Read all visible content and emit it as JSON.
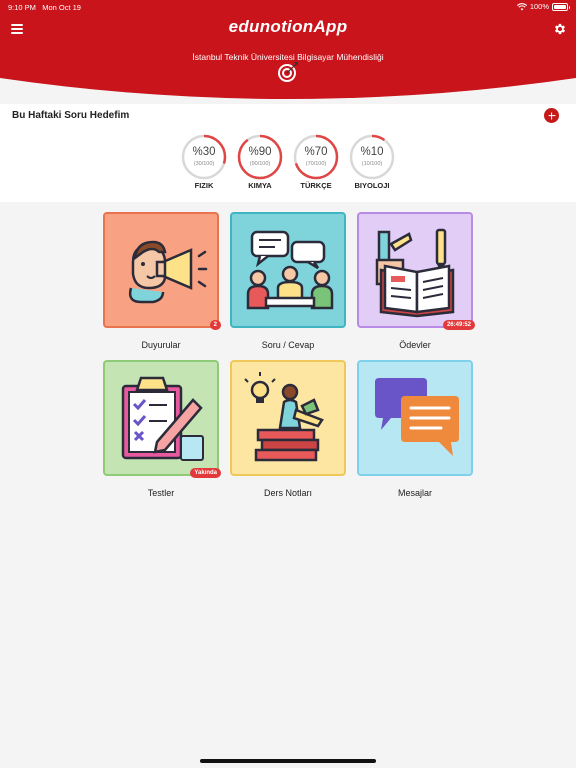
{
  "status_bar": {
    "time": "9:10 PM",
    "date": "Mon Oct 19",
    "battery": "100%"
  },
  "header": {
    "title": "edunotionApp",
    "subtitle": "İstanbul Teknik Üniversitesi Bilgisayar Mühendisliği",
    "colors": {
      "primary": "#c9141c",
      "accent": "#b01018"
    },
    "icons": {
      "menu": "hamburger-icon",
      "settings": "gear-icon",
      "target": "target-icon"
    }
  },
  "goals": {
    "title": "Bu Haftaki Soru Hedefim",
    "items": [
      {
        "percent": "%30",
        "fraction": "(30/100)",
        "label": "FIZIK",
        "progress": 0.3
      },
      {
        "percent": "%90",
        "fraction": "(90/100)",
        "label": "KIMYA",
        "progress": 0.9
      },
      {
        "percent": "%70",
        "fraction": "(70/100)",
        "label": "TÜRKÇE",
        "progress": 0.7
      },
      {
        "percent": "%10",
        "fraction": "(10/100)",
        "label": "BIYOLOJI",
        "progress": 0.1
      }
    ]
  },
  "tiles": [
    {
      "label": "Duyurular",
      "badge": "2",
      "color": "#f9a183"
    },
    {
      "label": "Soru / Cevap",
      "badge": "",
      "color": "#7fd4dc"
    },
    {
      "label": "Ödevler",
      "badge": "26:49:52",
      "color": "#e2cdf6"
    },
    {
      "label": "Testler",
      "badge": "Yakında",
      "color": "#c5e4b4"
    },
    {
      "label": "Ders Notları",
      "badge": "",
      "color": "#fde6a2"
    },
    {
      "label": "Mesajlar",
      "badge": "",
      "color": "#b8e7f4"
    }
  ]
}
